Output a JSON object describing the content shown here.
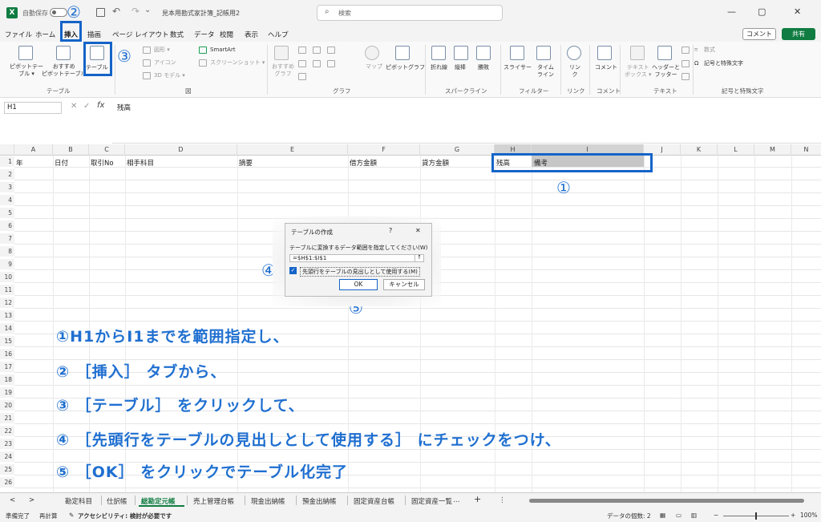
{
  "titlebar": {
    "app_icon": "X",
    "autosave_label": "自動保存",
    "doc_title": "見本用勘式家計簿_記帳用2",
    "search_placeholder": "検索",
    "minimize": "—",
    "maximize": "▢",
    "close": "✕"
  },
  "menu": {
    "tabs": [
      "ファイル",
      "ホーム",
      "挿入",
      "描画",
      "ページ レイアウト",
      "数式",
      "データ",
      "校閲",
      "表示",
      "ヘルプ"
    ],
    "comment": "コメント",
    "share": "共有"
  },
  "ribbon": {
    "pivot": "ピボットテー\nブル ▾",
    "recommended_pivot": "おすすめ\nピボットテーブル",
    "table": "テーブル",
    "shapes": "図形 ▾",
    "icons": "アイコン",
    "models": "3D モデル ▾",
    "smartart": "SmartArt",
    "screenshot": "スクリーンショット ▾",
    "recommended_charts": "おすすめ\nグラフ",
    "maps": "マップ",
    "pivot_chart": "ピボットグラフ",
    "spark_line": "折れ線",
    "spark_column": "縦棒",
    "spark_winloss": "勝敗",
    "slicer": "スライサー",
    "timeline": "タイム\nライン",
    "link": "リン\nク",
    "comment": "コメント",
    "textbox": "テキスト\nボックス ▾",
    "header_footer": "ヘッダーと\nフッター",
    "equation": "数式",
    "symbol": "記号と特殊文字",
    "groups": [
      "テーブル",
      "図",
      "グラフ",
      "スパークライン",
      "フィルター",
      "リンク",
      "コメント",
      "テキスト",
      "記号と特殊文字"
    ]
  },
  "formula_bar": {
    "name_box": "H1",
    "cancel": "✕",
    "enter": "✓",
    "fx": "fx",
    "content": "残高"
  },
  "columns": [
    "A",
    "B",
    "C",
    "D",
    "E",
    "F",
    "G",
    "H",
    "I",
    "J",
    "K",
    "L",
    "M",
    "N"
  ],
  "rows": [
    "1",
    "2",
    "3",
    "4",
    "5",
    "6",
    "7",
    "8",
    "9",
    "10",
    "11",
    "12",
    "13",
    "14",
    "15",
    "16",
    "17",
    "18",
    "19",
    "20",
    "21",
    "22",
    "23",
    "24",
    "25",
    "26"
  ],
  "row1": {
    "A": "年",
    "B": "日付",
    "C": "取引No",
    "D": "相手科目",
    "E": "摘要",
    "F": "借方金額",
    "G": "貸方金額",
    "H": "残高",
    "I": "備考"
  },
  "dialog": {
    "title": "テーブルの作成",
    "help": "?",
    "close": "✕",
    "prompt": "テーブルに変換するデータ範囲を指定してください(W)",
    "range": "=$H$1:$I$1",
    "collapse": "↑",
    "checkbox_label": "先頭行をテーブルの見出しとして使用する(M)",
    "ok": "OK",
    "cancel": "キャンセル"
  },
  "annotations": {
    "n1": "①",
    "n2": "②",
    "n3": "③",
    "n4": "④",
    "n5": "⑤"
  },
  "instructions": [
    "①H1からI1までを範囲指定し、",
    "② ［挿入］ タブから、",
    "③ ［テーブル］ をクリックして、",
    "④ ［先頭行をテーブルの見出しとして使用する］ にチェックをつけ、",
    "⑤ ［OK］ をクリックでテーブル化完了"
  ],
  "sheets": {
    "prev": "<",
    "next": ">",
    "tabs": [
      "勘定科目",
      "仕訳帳",
      "総勘定元帳",
      "売上管理台帳",
      "現金出納帳",
      "預金出納帳",
      "固定資産台帳",
      "固定資産一覧"
    ],
    "more": "…",
    "add": "+",
    "options": "⋮"
  },
  "status": {
    "ready": "準備完了",
    "recalc": "再計算",
    "accessibility": "アクセシビリティ: 検討が必要です",
    "count": "データの個数: 2",
    "zoom": "100%"
  },
  "colors": {
    "accent": "#107c41",
    "annotation": "#1464c8",
    "selection_fill": "#c6c6c6"
  }
}
